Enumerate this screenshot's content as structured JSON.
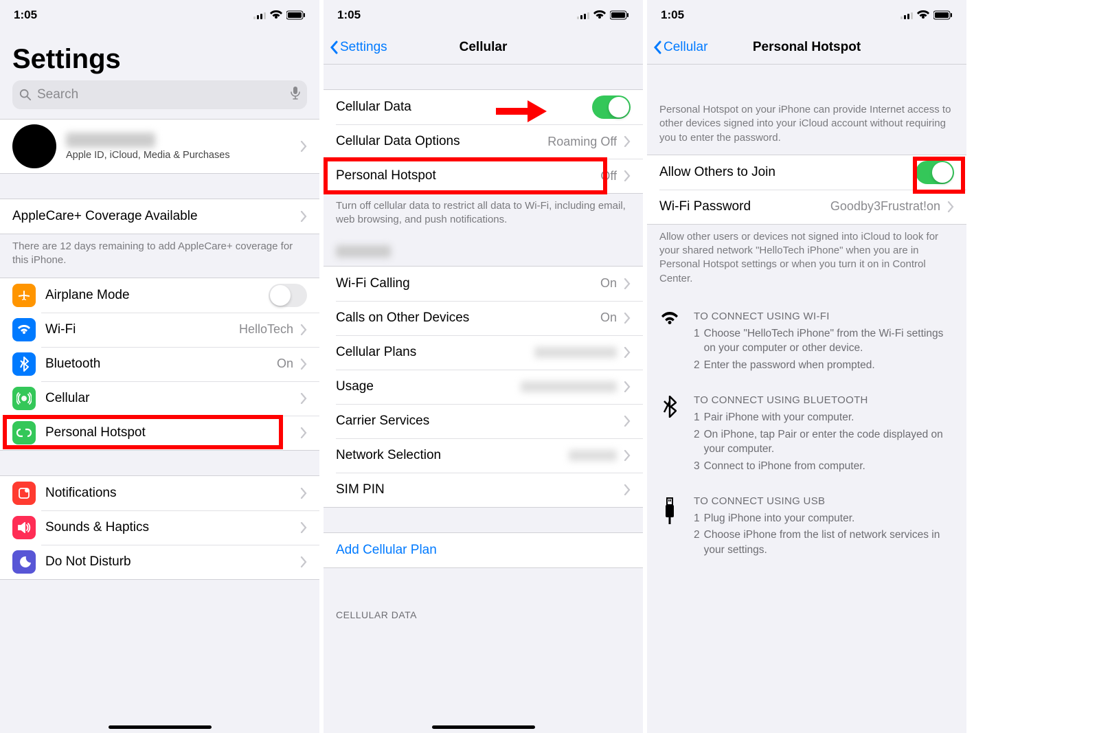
{
  "status": {
    "time": "1:05"
  },
  "p1": {
    "title": "Settings",
    "search_placeholder": "Search",
    "account_subtitle": "Apple ID, iCloud, Media & Purchases",
    "applecare": {
      "title": "AppleCare+ Coverage Available",
      "footer": "There are 12 days remaining to add AppleCare+ coverage for this iPhone."
    },
    "rows": [
      {
        "label": "Airplane Mode"
      },
      {
        "label": "Wi-Fi",
        "value": "HelloTech"
      },
      {
        "label": "Bluetooth",
        "value": "On"
      },
      {
        "label": "Cellular"
      },
      {
        "label": "Personal Hotspot"
      }
    ],
    "rows2": [
      {
        "label": "Notifications"
      },
      {
        "label": "Sounds & Haptics"
      },
      {
        "label": "Do Not Disturb"
      }
    ]
  },
  "p2": {
    "back": "Settings",
    "title": "Cellular",
    "rows1": [
      {
        "label": "Cellular Data"
      },
      {
        "label": "Cellular Data Options",
        "value": "Roaming Off"
      },
      {
        "label": "Personal Hotspot",
        "value": "Off"
      }
    ],
    "footer1": "Turn off cellular data to restrict all data to Wi-Fi, including email, web browsing, and push notifications.",
    "rows2": [
      {
        "label": "Wi-Fi Calling",
        "value": "On"
      },
      {
        "label": "Calls on Other Devices",
        "value": "On"
      },
      {
        "label": "Cellular Plans"
      },
      {
        "label": "Usage"
      },
      {
        "label": "Carrier Services"
      },
      {
        "label": "Network Selection"
      },
      {
        "label": "SIM PIN"
      }
    ],
    "add_plan": "Add Cellular Plan",
    "header2": "CELLULAR DATA"
  },
  "p3": {
    "back": "Cellular",
    "title": "Personal Hotspot",
    "intro": "Personal Hotspot on your iPhone can provide Internet access to other devices signed into your iCloud account without requiring you to enter the password.",
    "rows": [
      {
        "label": "Allow Others to Join"
      },
      {
        "label": "Wi-Fi Password",
        "value": "Goodby3Frustrat!on"
      }
    ],
    "footer": "Allow other users or devices not signed into iCloud to look for your shared network \"HelloTech iPhone\" when you are in Personal Hotspot settings or when you turn it on in Control Center.",
    "instr": [
      {
        "title": "TO CONNECT USING WI-FI",
        "steps": [
          "Choose \"HelloTech iPhone\" from the Wi-Fi settings on your computer or other device.",
          "Enter the password when prompted."
        ]
      },
      {
        "title": "TO CONNECT USING BLUETOOTH",
        "steps": [
          "Pair iPhone with your computer.",
          "On iPhone, tap Pair or enter the code displayed on your computer.",
          "Connect to iPhone from computer."
        ]
      },
      {
        "title": "TO CONNECT USING USB",
        "steps": [
          "Plug iPhone into your computer.",
          "Choose iPhone from the list of network services in your settings."
        ]
      }
    ]
  }
}
